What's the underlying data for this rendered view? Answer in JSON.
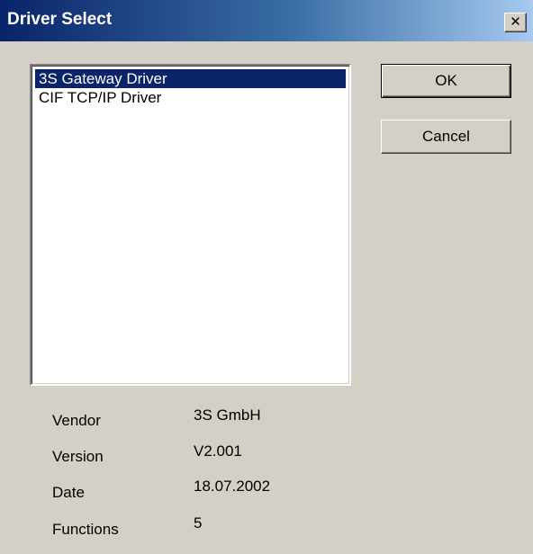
{
  "window": {
    "title": "Driver Select",
    "close_label": "✕",
    "close_glyph_note": ""
  },
  "driver_list": {
    "items": [
      {
        "label": "3S Gateway Driver",
        "selected": true
      },
      {
        "label": "CIF TCP/IP Driver",
        "selected": false
      }
    ]
  },
  "buttons": {
    "ok_label": "OK",
    "cancel_label": "Cancel"
  },
  "info": {
    "vendor_label": "Vendor",
    "vendor_value": "3S GmbH",
    "version_label": "Version",
    "version_value": "V2.001",
    "date_label": "Date",
    "date_value": "18.07.2002",
    "functions_label": "Functions",
    "functions_value": "5"
  },
  "colors": {
    "selection": "#0a246a",
    "dialog_background": "#d4d0c8"
  }
}
